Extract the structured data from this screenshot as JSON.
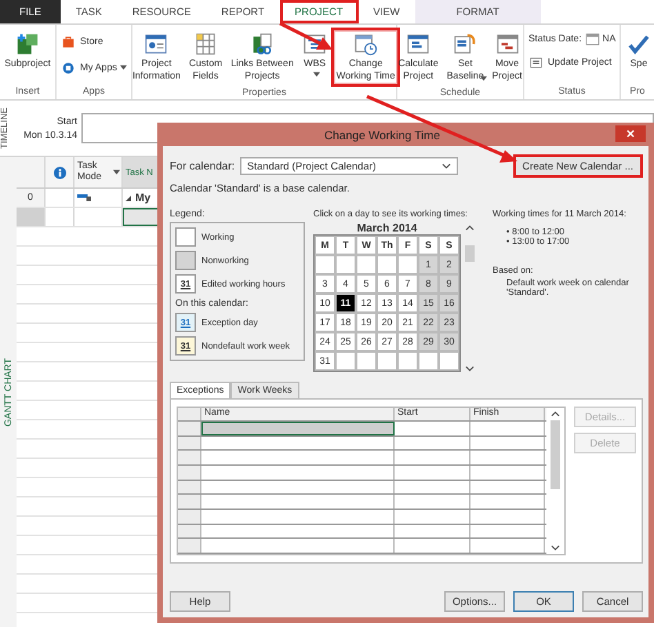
{
  "ribbon_tabs": [
    {
      "label": "FILE",
      "kind": "file",
      "selected": false,
      "highlighted": false
    },
    {
      "label": "TASK",
      "kind": "tab",
      "selected": false,
      "highlighted": false
    },
    {
      "label": "RESOURCE",
      "kind": "tab",
      "selected": false,
      "highlighted": false
    },
    {
      "label": "REPORT",
      "kind": "tab",
      "selected": false,
      "highlighted": false
    },
    {
      "label": "PROJECT",
      "kind": "tab",
      "selected": true,
      "highlighted": true
    },
    {
      "label": "VIEW",
      "kind": "tab",
      "selected": false,
      "highlighted": false
    },
    {
      "label": "FORMAT",
      "kind": "contextual",
      "selected": false,
      "highlighted": false
    }
  ],
  "ribbon_groups": [
    {
      "label": "Insert",
      "commands": [
        {
          "label": "Subproject",
          "kind": "large",
          "dropdown": false,
          "highlighted": false
        }
      ]
    },
    {
      "label": "Apps",
      "commands": [
        {
          "label": "Store",
          "kind": "small",
          "dropdown": false,
          "highlighted": false
        },
        {
          "label": "My Apps",
          "kind": "small",
          "dropdown": true,
          "highlighted": false
        }
      ]
    },
    {
      "label": "Properties",
      "commands": [
        {
          "label": "Project Information",
          "kind": "large",
          "dropdown": false,
          "highlighted": false
        },
        {
          "label": "Custom Fields",
          "kind": "large",
          "dropdown": false,
          "highlighted": false
        },
        {
          "label": "Links Between Projects",
          "kind": "large",
          "dropdown": false,
          "highlighted": false
        },
        {
          "label": "WBS",
          "kind": "large",
          "dropdown": true,
          "highlighted": false
        },
        {
          "label": "Change Working Time",
          "kind": "large",
          "dropdown": false,
          "highlighted": true
        }
      ]
    },
    {
      "label": "Schedule",
      "commands": [
        {
          "label": "Calculate Project",
          "kind": "large",
          "dropdown": false,
          "highlighted": false
        },
        {
          "label": "Set Baseline",
          "kind": "large",
          "dropdown": true,
          "highlighted": false
        },
        {
          "label": "Move Project",
          "kind": "large",
          "dropdown": false,
          "highlighted": false
        }
      ]
    },
    {
      "label": "Status",
      "commands": [
        {
          "label": "Status Date:",
          "kind": "field",
          "value": "NA"
        },
        {
          "label": "Update Project",
          "kind": "small",
          "dropdown": false,
          "highlighted": false
        }
      ]
    },
    {
      "label": "Pro",
      "commands": [
        {
          "label": "Spe",
          "kind": "large",
          "dropdown": false,
          "highlighted": false
        }
      ]
    }
  ],
  "timeline": {
    "title": "TIMELINE",
    "start_label": "Start",
    "start_date": "Mon 10.3.14"
  },
  "gantt": {
    "view_label": "GANTT CHART",
    "columns": [
      {
        "kind": "info"
      },
      {
        "kind": "mode",
        "label": "Task Mode",
        "dropdown": true
      },
      {
        "kind": "name",
        "label": "Task N"
      }
    ],
    "rows": [
      {
        "id": "0",
        "name": "My",
        "summary": true,
        "selected": false
      },
      {
        "summary": false,
        "selected": true
      }
    ]
  },
  "dialog": {
    "title": "Change Working Time",
    "for_calendar_label": "For calendar:",
    "calendar_value": "Standard (Project Calendar)",
    "create_button": {
      "label": "Create New Calendar ...",
      "highlighted": true
    },
    "base_note": "Calendar 'Standard' is a base calendar.",
    "legend": {
      "title": "Legend:",
      "items": [
        {
          "label": "Working",
          "kind": "working"
        },
        {
          "label": "Nonworking",
          "kind": "nonworking"
        },
        {
          "label": "Edited working hours",
          "kind": "edited",
          "swatch_text": "31"
        }
      ],
      "subheading": "On this calendar:",
      "calendar_items": [
        {
          "label": "Exception day",
          "kind": "exception",
          "swatch_text": "31"
        },
        {
          "label": "Nondefault work week",
          "kind": "nondefault",
          "swatch_text": "31"
        }
      ]
    },
    "calendar": {
      "instruction": "Click on a day to see its working times:",
      "month": "March 2014",
      "weekdays": [
        "M",
        "T",
        "W",
        "Th",
        "F",
        "S",
        "S"
      ],
      "weeks": [
        [
          {
            "kind": "blank"
          },
          {
            "kind": "blank"
          },
          {
            "kind": "blank"
          },
          {
            "kind": "blank"
          },
          {
            "kind": "blank"
          },
          {
            "day": "1",
            "kind": "nonworking",
            "selected": false
          },
          {
            "day": "2",
            "kind": "nonworking",
            "selected": false
          }
        ],
        [
          {
            "day": "3",
            "kind": "working",
            "selected": false
          },
          {
            "day": "4",
            "kind": "working",
            "selected": false
          },
          {
            "day": "5",
            "kind": "working",
            "selected": false
          },
          {
            "day": "6",
            "kind": "working",
            "selected": false
          },
          {
            "day": "7",
            "kind": "working",
            "selected": false
          },
          {
            "day": "8",
            "kind": "nonworking",
            "selected": false
          },
          {
            "day": "9",
            "kind": "nonworking",
            "selected": false
          }
        ],
        [
          {
            "day": "10",
            "kind": "working",
            "selected": false
          },
          {
            "day": "11",
            "kind": "working",
            "selected": true
          },
          {
            "day": "12",
            "kind": "working",
            "selected": false
          },
          {
            "day": "13",
            "kind": "working",
            "selected": false
          },
          {
            "day": "14",
            "kind": "working",
            "selected": false
          },
          {
            "day": "15",
            "kind": "nonworking",
            "selected": false
          },
          {
            "day": "16",
            "kind": "nonworking",
            "selected": false
          }
        ],
        [
          {
            "day": "17",
            "kind": "working",
            "selected": false
          },
          {
            "day": "18",
            "kind": "working",
            "selected": false
          },
          {
            "day": "19",
            "kind": "working",
            "selected": false
          },
          {
            "day": "20",
            "kind": "working",
            "selected": false
          },
          {
            "day": "21",
            "kind": "working",
            "selected": false
          },
          {
            "day": "22",
            "kind": "nonworking",
            "selected": false
          },
          {
            "day": "23",
            "kind": "nonworking",
            "selected": false
          }
        ],
        [
          {
            "day": "24",
            "kind": "working",
            "selected": false
          },
          {
            "day": "25",
            "kind": "working",
            "selected": false
          },
          {
            "day": "26",
            "kind": "working",
            "selected": false
          },
          {
            "day": "27",
            "kind": "working",
            "selected": false
          },
          {
            "day": "28",
            "kind": "working",
            "selected": false
          },
          {
            "day": "29",
            "kind": "nonworking",
            "selected": false
          },
          {
            "day": "30",
            "kind": "nonworking",
            "selected": false
          }
        ],
        [
          {
            "day": "31",
            "kind": "working",
            "selected": false
          },
          {
            "kind": "blank"
          },
          {
            "kind": "blank"
          },
          {
            "kind": "blank"
          },
          {
            "kind": "blank"
          },
          {
            "kind": "blank"
          },
          {
            "kind": "blank"
          }
        ]
      ]
    },
    "working_times": {
      "heading": "Working times for 11 March 2014:",
      "times": [
        "• 8:00 to 12:00",
        "• 13:00 to 17:00"
      ],
      "based_on_label": "Based on:",
      "based_on": "Default work week on calendar 'Standard'."
    },
    "tabs": [
      {
        "label": "Exceptions",
        "selected": true
      },
      {
        "label": "Work Weeks",
        "selected": false
      }
    ],
    "table": {
      "columns": [
        "Name",
        "Start",
        "Finish"
      ],
      "rows": [
        {
          "selected": true
        },
        {
          "selected": false
        },
        {
          "selected": false
        },
        {
          "selected": false
        },
        {
          "selected": false
        },
        {
          "selected": false
        },
        {
          "selected": false
        },
        {
          "selected": false
        },
        {
          "selected": false
        }
      ]
    },
    "side_buttons": [
      {
        "label": "Details...",
        "disabled": true
      },
      {
        "label": "Delete",
        "disabled": true
      }
    ],
    "buttons": [
      {
        "label": "Help",
        "kind": "left",
        "default": false
      },
      {
        "label": "Options...",
        "kind": "right",
        "default": false
      },
      {
        "label": "OK",
        "kind": "right",
        "default": true
      },
      {
        "label": "Cancel",
        "kind": "right",
        "default": false
      }
    ]
  }
}
